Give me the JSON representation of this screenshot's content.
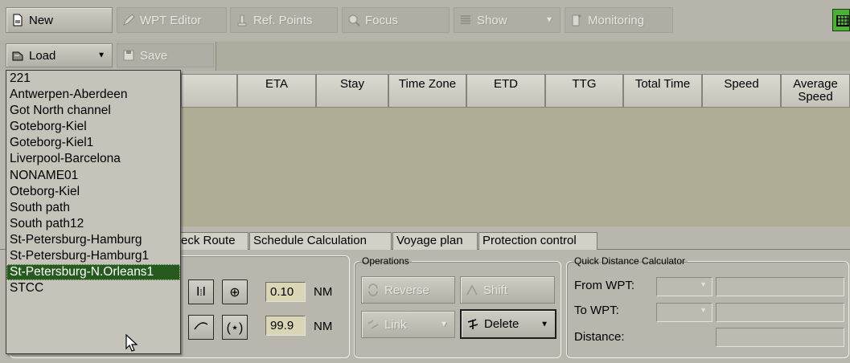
{
  "toolbar_top": {
    "new": "New",
    "wpt_editor": "WPT Editor",
    "ref_points": "Ref. Points",
    "focus": "Focus",
    "show": "Show",
    "monitoring": "Monitoring"
  },
  "toolbar_second": {
    "load": "Load",
    "save": "Save"
  },
  "table_headers": [
    "ETA",
    "Stay",
    "Time Zone",
    "ETD",
    "TTG",
    "Total Time",
    "Speed",
    "Average Speed"
  ],
  "tabs": [
    "eck Route",
    "Schedule Calculation",
    "Voyage plan",
    "Protection control"
  ],
  "params": {
    "value1": "0.10",
    "unit1": "NM",
    "value2": "99.9",
    "unit2": "NM"
  },
  "operations": {
    "title": "Operations",
    "reverse": "Reverse",
    "shift": "Shift",
    "link": "Link",
    "delete": "Delete"
  },
  "quick_calc": {
    "title": "Quick Distance Calculator",
    "from_wpt": "From WPT:",
    "to_wpt": "To WPT:",
    "distance": "Distance:"
  },
  "route_list": {
    "items": [
      "221",
      "Antwerpen-Aberdeen",
      "Got North channel",
      "Goteborg-Kiel",
      "Goteborg-Kiel1",
      "Liverpool-Barcelona",
      "NONAME01",
      "Oteborg-Kiel",
      "South path",
      "South path12",
      "St-Petersburg-Hamburg",
      "St-Petersburg-Hamburg1",
      "St-Petersburg-N.Orleans1",
      "STCC"
    ],
    "selected_index": 12
  },
  "colors": {
    "selection": "#275a1e",
    "table_body": "#aeac92",
    "value_field": "#d8d6b4"
  }
}
